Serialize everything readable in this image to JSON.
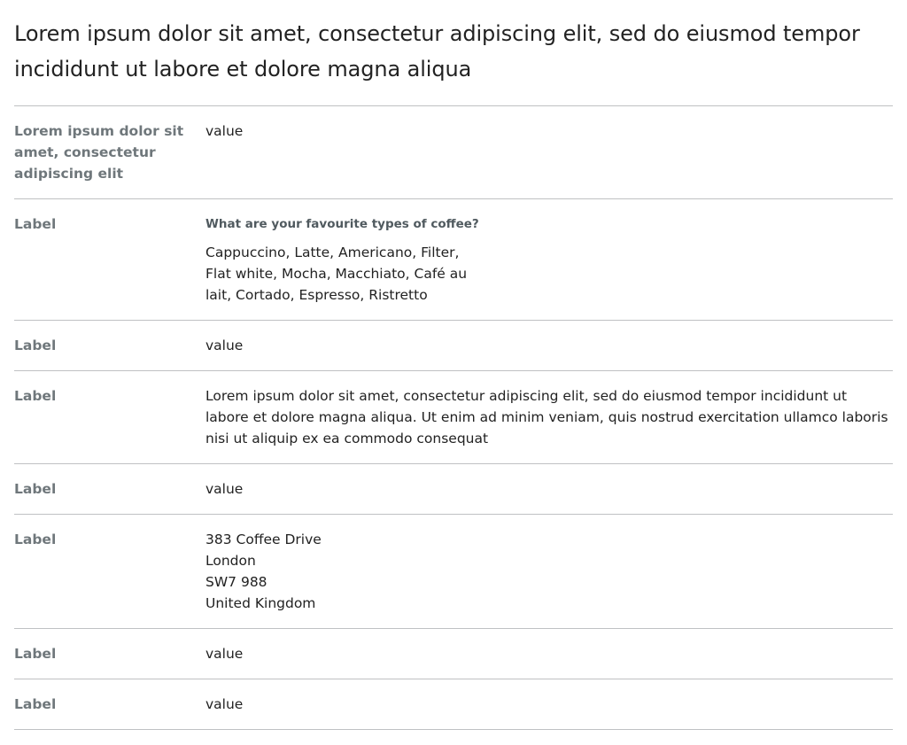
{
  "heading": "Lorem ipsum dolor sit amet, consectetur adipiscing elit, sed do eiusmod tempor incididunt ut labore et dolore magna aliqua",
  "rows": [
    {
      "key": "Lorem ipsum dolor sit amet, consectetur adipiscing elit",
      "value": "value"
    },
    {
      "key": "Label",
      "question": "What are your favourite types of coffee?",
      "answer": "Cappuccino, Latte, Americano, Filter, Flat white, Mocha, Macchiato, Café au lait, Cortado, Espresso, Ristretto"
    },
    {
      "key": "Label",
      "value": "value"
    },
    {
      "key": "Label",
      "value": "Lorem ipsum dolor sit amet, consectetur adipiscing elit, sed do eiusmod tempor incididunt ut labore et dolore magna aliqua. Ut enim ad minim veniam, quis nostrud exercitation ullamco laboris nisi ut aliquip ex ea commodo consequat"
    },
    {
      "key": "Label",
      "value": "value"
    },
    {
      "key": "Label",
      "address": [
        "383 Coffee Drive",
        "London",
        "SW7 988",
        "United Kingdom"
      ]
    },
    {
      "key": "Label",
      "value": "value"
    },
    {
      "key": "Label",
      "value": "value"
    }
  ]
}
